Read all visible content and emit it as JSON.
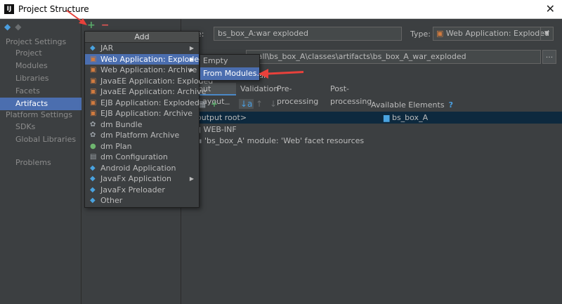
{
  "window": {
    "title": "Project Structure",
    "app_icon": "IJ",
    "close_glyph": "✕"
  },
  "nav": {
    "back_glyph": "◆",
    "forward_glyph": "◆",
    "project_settings_header": "Project Settings",
    "project_items": [
      "Project",
      "Modules",
      "Libraries",
      "Facets",
      "Artifacts"
    ],
    "platform_settings_header": "Platform Settings",
    "platform_items": [
      "SDKs",
      "Global Libraries"
    ],
    "problems": "Problems",
    "selected": "Artifacts"
  },
  "toolbar": {
    "add_glyph": "+",
    "remove_glyph": "−"
  },
  "add_popup": {
    "header": "Add",
    "items": [
      {
        "label": "JAR",
        "icon": "jar-icon",
        "submenu": true
      },
      {
        "label": "Web Application: Exploded",
        "icon": "web-app-icon",
        "submenu": true,
        "highlighted": true
      },
      {
        "label": "Web Application: Archive",
        "icon": "web-app-icon",
        "submenu": true
      },
      {
        "label": "JavaEE Application: Exploded",
        "icon": "javaee-icon",
        "submenu": false
      },
      {
        "label": "JavaEE Application: Archive",
        "icon": "javaee-icon",
        "submenu": false
      },
      {
        "label": "EJB Application: Exploded",
        "icon": "ejb-icon",
        "submenu": false
      },
      {
        "label": "EJB Application: Archive",
        "icon": "ejb-icon",
        "submenu": false
      },
      {
        "label": "dm Bundle",
        "icon": "dm-bundle-icon",
        "submenu": false
      },
      {
        "label": "dm Platform Archive",
        "icon": "dm-platform-icon",
        "submenu": false
      },
      {
        "label": "dm Plan",
        "icon": "dm-plan-icon",
        "submenu": false
      },
      {
        "label": "dm Configuration",
        "icon": "dm-config-icon",
        "submenu": false
      },
      {
        "label": "Android Application",
        "icon": "android-icon",
        "submenu": false
      },
      {
        "label": "JavaFx Application",
        "icon": "javafx-icon",
        "submenu": true
      },
      {
        "label": "JavaFx Preloader",
        "icon": "javafx-icon",
        "submenu": false
      },
      {
        "label": "Other",
        "icon": "other-icon",
        "submenu": false
      }
    ]
  },
  "submenu": {
    "items": [
      "Empty",
      "From Modules..."
    ],
    "highlighted": "From Modules..."
  },
  "artifact": {
    "name_label_fragment": "e:",
    "name_value": "bs_box_A:war exploded",
    "type_label": "Type:",
    "type_value": "Web Application: Exploded",
    "output_path_fragment": "mall\\bs_box_A\\classes\\artifacts\\bs_box_A_war_exploded",
    "browse_glyph": "...",
    "partial_label": "ui"
  },
  "tabs": [
    "Output Layout",
    "Validation",
    "Pre-processing",
    "Post-processing"
  ],
  "tabs_visible_text": [
    "put Layout",
    "Validation",
    "Pre-processing",
    "Post-processing"
  ],
  "layout_toolbar": {
    "add_glyph": "+",
    "remove_glyph": "−",
    "sort_glyph": "↓a",
    "up_glyph": "↑",
    "down_glyph": "↓"
  },
  "available_elements": {
    "label": "Available Elements",
    "help": "?"
  },
  "tree": {
    "root": "output root>",
    "web_inf": "WEB-INF",
    "facet_resources": "'bs_box_A' module: 'Web' facet resources",
    "available_module": "bs_box_A"
  },
  "colors": {
    "accent": "#4b6eaf",
    "plus": "#59a869",
    "minus": "#e05555",
    "annotation_arrow": "#e8413b"
  }
}
